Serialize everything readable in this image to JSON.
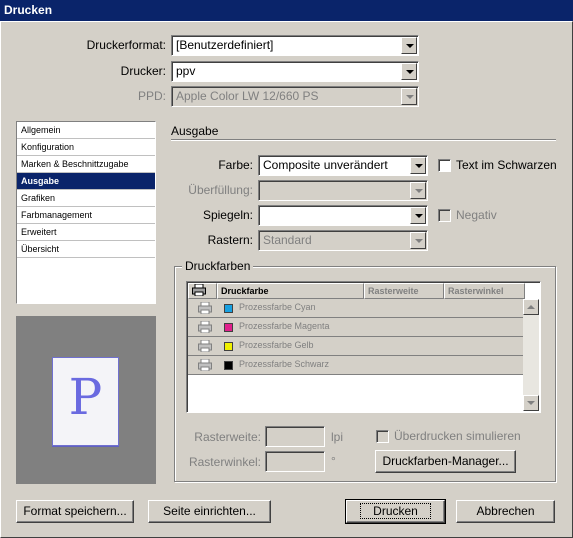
{
  "window": {
    "title": "Drucken"
  },
  "printer_settings": {
    "format_label": "Druckerformat:",
    "format_value": "[Benutzerdefiniert]",
    "printer_label": "Drucker:",
    "printer_value": "ppv",
    "ppd_label": "PPD:",
    "ppd_value": "Apple Color LW 12/660 PS"
  },
  "nav": {
    "items": [
      {
        "label": "Allgemein"
      },
      {
        "label": "Konfiguration"
      },
      {
        "label": "Marken & Beschnittzugabe"
      },
      {
        "label": "Ausgabe"
      },
      {
        "label": "Grafiken"
      },
      {
        "label": "Farbmanagement"
      },
      {
        "label": "Erweitert"
      },
      {
        "label": "Übersicht"
      }
    ],
    "selected": "Ausgabe"
  },
  "preview": {
    "letter": "P"
  },
  "output": {
    "section_title": "Ausgabe",
    "farbe_label": "Farbe:",
    "farbe_value": "Composite unverändert",
    "ueberfuellung_label": "Überfüllung:",
    "ueberfuellung_value": "",
    "spiegeln_label": "Spiegeln:",
    "spiegeln_value": "",
    "rastern_label": "Rastern:",
    "rastern_value": "Standard",
    "text_schwarz_label": "Text im Schwarzen",
    "negativ_label": "Negativ"
  },
  "inks": {
    "group_title": "Druckfarben",
    "columns": [
      "Druckfarbe",
      "Rasterweite",
      "Rasterwinkel"
    ],
    "rows": [
      {
        "name": "Prozessfarbe Cyan",
        "color": "#18a0e0"
      },
      {
        "name": "Prozessfarbe Magenta",
        "color": "#e0208c"
      },
      {
        "name": "Prozessfarbe Gelb",
        "color": "#f0f000"
      },
      {
        "name": "Prozessfarbe Schwarz",
        "color": "#000000"
      }
    ],
    "rasterweite_label": "Rasterweite:",
    "rasterweite_unit": "lpi",
    "rasterwinkel_label": "Rasterwinkel:",
    "rasterwinkel_unit": "°",
    "ueberdrucken_label": "Überdrucken simulieren",
    "manager_button": "Druckfarben-Manager..."
  },
  "buttons": {
    "save_format": "Format speichern...",
    "page_setup": "Seite einrichten...",
    "print": "Drucken",
    "cancel": "Abbrechen"
  }
}
